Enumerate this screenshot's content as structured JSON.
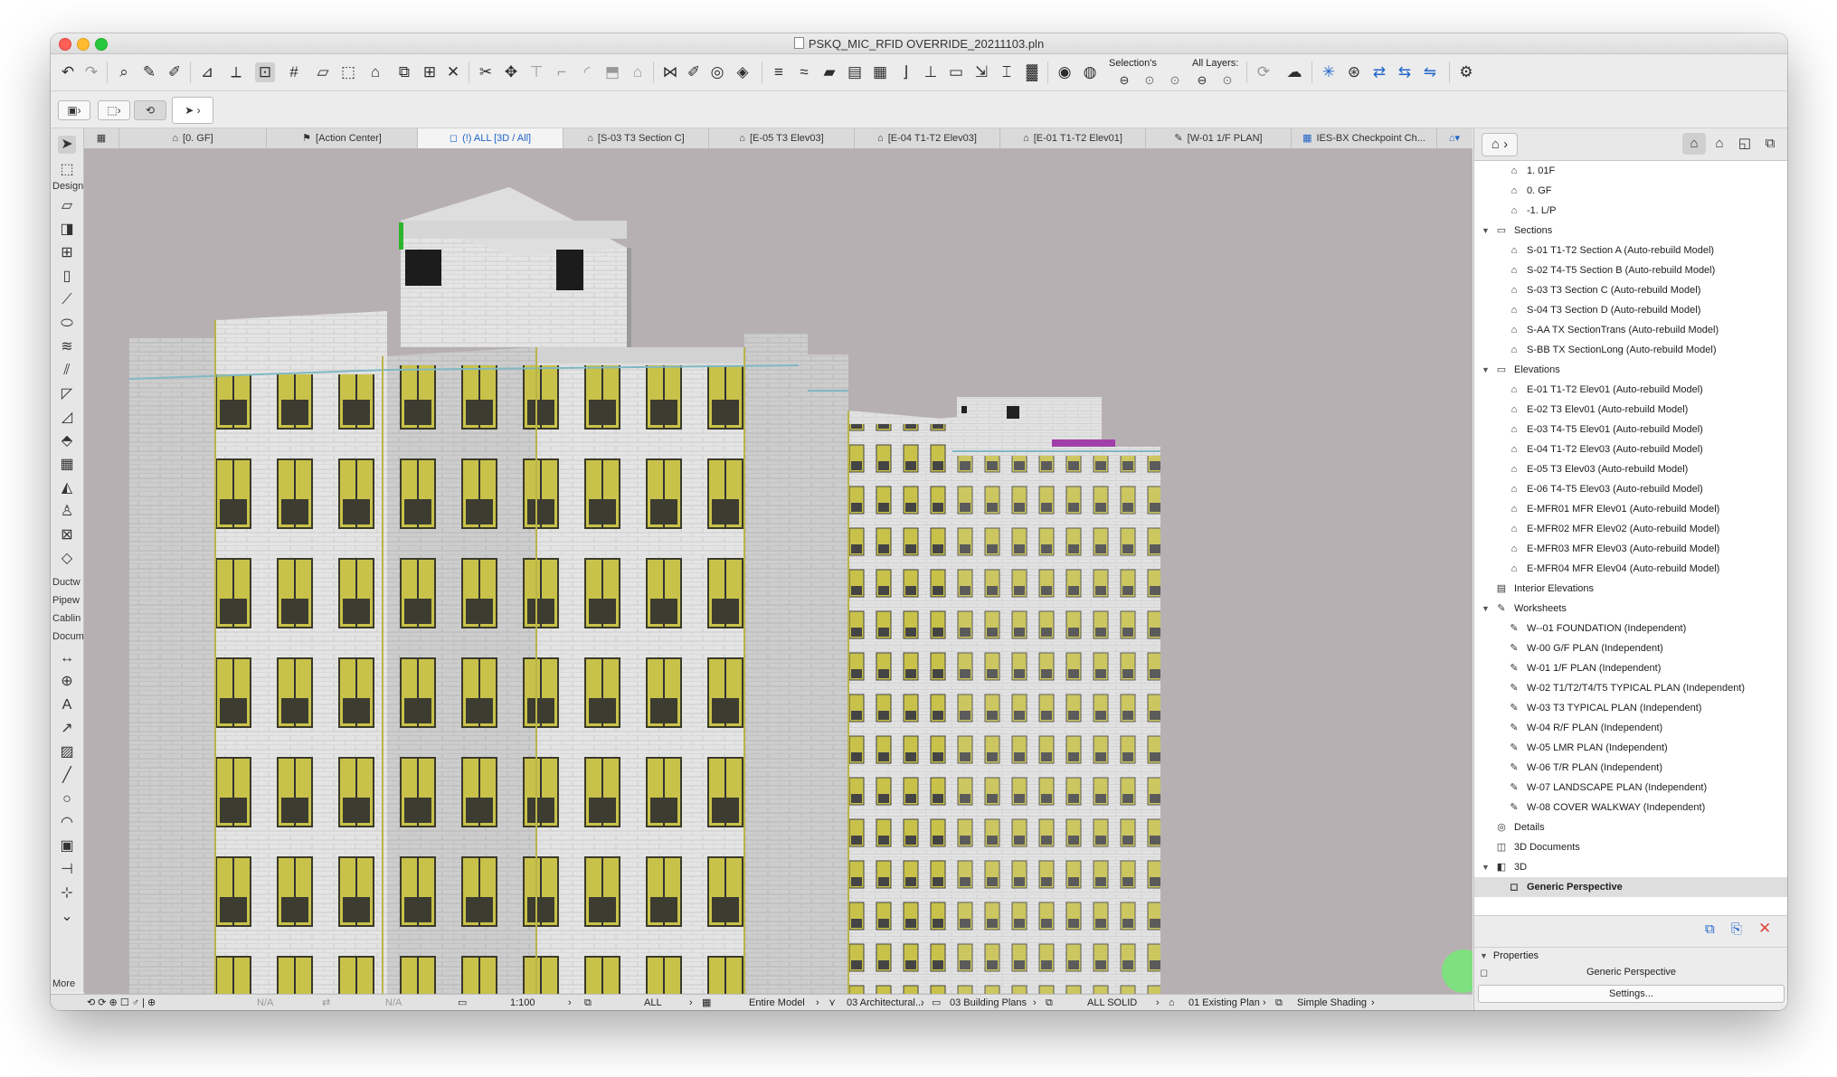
{
  "window": {
    "title": "PSKQ_MIC_RFID OVERRIDE_20211103.pln"
  },
  "toolbar": {
    "selections_label": "Selection's",
    "all_layers_label": "All Layers:",
    "icons": [
      "undo-icon",
      "redo-icon",
      "find-select-icon",
      "pick-up-icon",
      "inject-icon",
      "ruler-icon",
      "snap-icon",
      "gravity-icon",
      "grid-icon",
      "trace-icon",
      "selection-box-icon",
      "lock-icon",
      "group-icon",
      "window-icon",
      "explode-icon",
      "cut-icon",
      "drag-icon",
      "trim-icon",
      "intersect-icon",
      "fillet-icon",
      "offset-icon",
      "roof-icon",
      "split-icon",
      "adjust-icon",
      "stretch-icon",
      "solid-ops-icon",
      "element-info-icon",
      "hotlink-icon",
      "wall-edit-icon",
      "slab-edit-icon",
      "mesh-icon",
      "stair-icon",
      "railing-icon",
      "curtain-icon",
      "beam-icon",
      "column-icon",
      "design-option-icon"
    ]
  },
  "tabs": [
    {
      "label": "[0. GF]",
      "icon": "floorplan-icon"
    },
    {
      "label": "[Action Center]",
      "icon": "action-center-icon"
    },
    {
      "label": "(!) ALL [3D / All]",
      "icon": "3d-window-icon",
      "active": true
    },
    {
      "label": "[S-03 T3 Section C]",
      "icon": "section-icon"
    },
    {
      "label": "[E-05 T3 Elev03]",
      "icon": "elevation-icon"
    },
    {
      "label": "[E-04 T1-T2 Elev03]",
      "icon": "elevation-icon"
    },
    {
      "label": "[E-01 T1-T2 Elev01]",
      "icon": "elevation-icon"
    },
    {
      "label": "[W-01 1/F PLAN]",
      "icon": "worksheet-icon"
    },
    {
      "label": "IES-BX Checkpoint Ch...",
      "icon": "schedule-icon"
    }
  ],
  "toolbox": {
    "labels": {
      "design": "Design",
      "ductwork": "Ductw",
      "pipework": "Pipew",
      "cabling": "Cablin",
      "document": "Docum",
      "more": "More"
    }
  },
  "navigator": {
    "items": [
      {
        "label": "1. 01F",
        "level": 2,
        "icon": "story-icon"
      },
      {
        "label": "0. GF",
        "level": 2,
        "icon": "story-icon"
      },
      {
        "label": "-1. L/P",
        "level": 2,
        "icon": "story-icon"
      },
      {
        "label": "Sections",
        "level": 1,
        "icon": "folder-icon",
        "expanded": true
      },
      {
        "label": "S-01 T1-T2 Section A (Auto-rebuild Model)",
        "level": 2,
        "icon": "section-icon"
      },
      {
        "label": "S-02 T4-T5 Section B (Auto-rebuild Model)",
        "level": 2,
        "icon": "section-icon"
      },
      {
        "label": "S-03 T3 Section C (Auto-rebuild Model)",
        "level": 2,
        "icon": "section-icon"
      },
      {
        "label": "S-04 T3 Section D (Auto-rebuild Model)",
        "level": 2,
        "icon": "section-icon"
      },
      {
        "label": "S-AA TX SectionTrans (Auto-rebuild Model)",
        "level": 2,
        "icon": "section-icon"
      },
      {
        "label": "S-BB TX SectionLong (Auto-rebuild Model)",
        "level": 2,
        "icon": "section-icon"
      },
      {
        "label": "Elevations",
        "level": 1,
        "icon": "folder-icon",
        "expanded": true
      },
      {
        "label": "E-01 T1-T2 Elev01 (Auto-rebuild Model)",
        "level": 2,
        "icon": "elevation-icon"
      },
      {
        "label": "E-02 T3 Elev01 (Auto-rebuild Model)",
        "level": 2,
        "icon": "elevation-icon"
      },
      {
        "label": "E-03 T4-T5 Elev01 (Auto-rebuild Model)",
        "level": 2,
        "icon": "elevation-icon"
      },
      {
        "label": "E-04 T1-T2 Elev03 (Auto-rebuild Model)",
        "level": 2,
        "icon": "elevation-icon"
      },
      {
        "label": "E-05 T3 Elev03 (Auto-rebuild Model)",
        "level": 2,
        "icon": "elevation-icon"
      },
      {
        "label": "E-06 T4-T5 Elev03 (Auto-rebuild Model)",
        "level": 2,
        "icon": "elevation-icon"
      },
      {
        "label": "E-MFR01 MFR Elev01 (Auto-rebuild Model)",
        "level": 2,
        "icon": "elevation-icon"
      },
      {
        "label": "E-MFR02 MFR Elev02 (Auto-rebuild Model)",
        "level": 2,
        "icon": "elevation-icon"
      },
      {
        "label": "E-MFR03 MFR Elev03 (Auto-rebuild Model)",
        "level": 2,
        "icon": "elevation-icon"
      },
      {
        "label": "E-MFR04 MFR Elev04 (Auto-rebuild Model)",
        "level": 2,
        "icon": "elevation-icon"
      },
      {
        "label": "Interior Elevations",
        "level": 1,
        "icon": "interior-elevation-icon"
      },
      {
        "label": "Worksheets",
        "level": 1,
        "icon": "worksheet-icon",
        "expanded": true
      },
      {
        "label": "W--01 FOUNDATION (Independent)",
        "level": 2,
        "icon": "worksheet-icon"
      },
      {
        "label": "W-00 G/F PLAN (Independent)",
        "level": 2,
        "icon": "worksheet-icon"
      },
      {
        "label": "W-01 1/F PLAN (Independent)",
        "level": 2,
        "icon": "worksheet-icon"
      },
      {
        "label": "W-02 T1/T2/T4/T5 TYPICAL PLAN (Independent)",
        "level": 2,
        "icon": "worksheet-icon"
      },
      {
        "label": "W-03 T3 TYPICAL PLAN (Independent)",
        "level": 2,
        "icon": "worksheet-icon"
      },
      {
        "label": "W-04 R/F PLAN (Independent)",
        "level": 2,
        "icon": "worksheet-icon"
      },
      {
        "label": "W-05 LMR PLAN (Independent)",
        "level": 2,
        "icon": "worksheet-icon"
      },
      {
        "label": "W-06 T/R PLAN (Independent)",
        "level": 2,
        "icon": "worksheet-icon"
      },
      {
        "label": "W-07 LANDSCAPE PLAN (Independent)",
        "level": 2,
        "icon": "worksheet-icon"
      },
      {
        "label": "W-08 COVER WALKWAY (Independent)",
        "level": 2,
        "icon": "worksheet-icon"
      },
      {
        "label": "Details",
        "level": 1,
        "icon": "detail-icon"
      },
      {
        "label": "3D Documents",
        "level": 1,
        "icon": "3d-document-icon"
      },
      {
        "label": "3D",
        "level": 1,
        "icon": "3d-icon",
        "expanded": true
      },
      {
        "label": "Generic Perspective",
        "level": 2,
        "icon": "perspective-icon",
        "selected": true
      }
    ],
    "properties_label": "Properties",
    "properties_value": "Generic Perspective",
    "settings_label": "Settings..."
  },
  "statusbar": {
    "na1": "N/A",
    "na2": "N/A",
    "scale": "1:100",
    "layer_combo": "ALL",
    "model_view": "Entire Model",
    "pen_set": "03 Architectural...",
    "mvo": "03 Building Plans",
    "graphic_override": "ALL SOLID",
    "renovation": "01 Existing Plan",
    "shading": "Simple Shading"
  },
  "colors": {
    "viewport_bg": "#b7b0b2",
    "facade_light": "#e3e3e3",
    "facade_shade": "#c9c9c9",
    "window_yellow": "#c9c24a",
    "accent_blue": "#1e64c8",
    "close_red": "#e0443e"
  }
}
